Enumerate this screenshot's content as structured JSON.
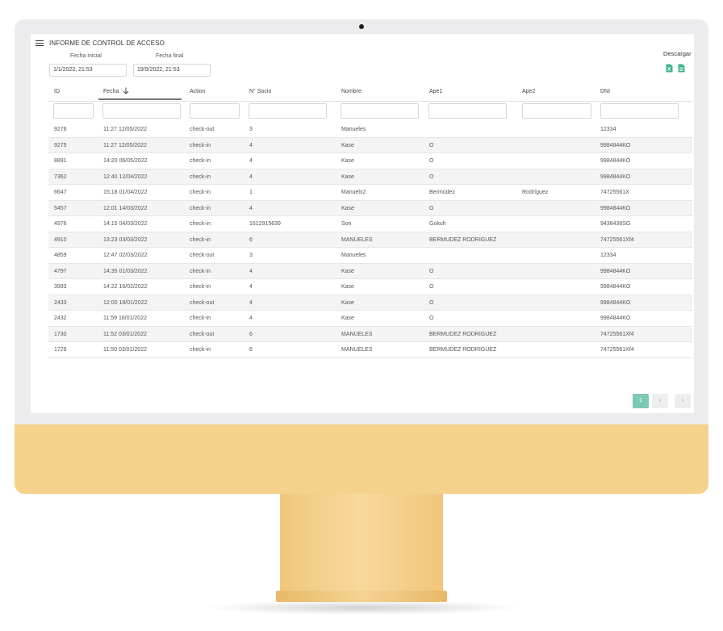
{
  "header": {
    "title": "INFORME DE CONTROL DE ACCESO"
  },
  "filters": {
    "start_label": "Fecha inicial",
    "start_value": "1/1/2022, 21:53",
    "end_label": "Fecha final",
    "end_value": "19/9/2022, 21:53"
  },
  "download": {
    "label": "Descargar",
    "excel_icon": "excel-file-icon",
    "csv_icon": "csv-file-icon",
    "icon_color": "#3fb28f"
  },
  "table": {
    "columns": [
      "ID",
      "Fecha",
      "Action",
      "N° Socio",
      "Nombre",
      "Ape1",
      "Ape2",
      "DNI"
    ],
    "sort_icon": "arrow-down-icon",
    "rows": [
      [
        "9276",
        "11:27 12/05/2022",
        "check-out",
        "3",
        "Manueles",
        "",
        "",
        "12334"
      ],
      [
        "9275",
        "11:27 12/05/2022",
        "check-in",
        "4",
        "Kase",
        "O",
        "",
        "9984844KO"
      ],
      [
        "8891",
        "14:20 06/05/2022",
        "check-in",
        "4",
        "Kase",
        "O",
        "",
        "9984844KO"
      ],
      [
        "7362",
        "12:40 12/04/2022",
        "check-in",
        "4",
        "Kase",
        "O",
        "",
        "9984844KO"
      ],
      [
        "6647",
        "15:18 01/04/2022",
        "check-in",
        "1",
        "Manuelx2",
        "Bermúdez",
        "Rodríguez",
        "74725561X"
      ],
      [
        "5457",
        "12:01 14/03/2022",
        "check-in",
        "4",
        "Kase",
        "O",
        "",
        "9984844KO"
      ],
      [
        "4976",
        "14:15 04/03/2022",
        "check-in",
        "1612915639",
        "Son",
        "Gokuh",
        "",
        "9438438SG"
      ],
      [
        "4910",
        "13:23 03/03/2022",
        "check-in",
        "6",
        "MANUELES",
        "BERMUDEZ RODRIGUEZ",
        "",
        "74725561Xf4"
      ],
      [
        "4859",
        "12:47 02/03/2022",
        "check-out",
        "3",
        "Manueles",
        "",
        "",
        "12334"
      ],
      [
        "4797",
        "14:35 01/03/2022",
        "check-in",
        "4",
        "Kase",
        "O",
        "",
        "9984844KO"
      ],
      [
        "3993",
        "14:22 16/02/2022",
        "check-in",
        "4",
        "Kase",
        "O",
        "",
        "9984844KO"
      ],
      [
        "2433",
        "12:00 18/01/2022",
        "check-out",
        "4",
        "Kase",
        "O",
        "",
        "9984844KO"
      ],
      [
        "2432",
        "11:59 18/01/2022",
        "check-in",
        "4",
        "Kase",
        "O",
        "",
        "9984844KO"
      ],
      [
        "1730",
        "11:52 03/01/2022",
        "check-out",
        "6",
        "MANUELES",
        "BERMUDEZ RODRIGUEZ",
        "",
        "74725561Xf4"
      ],
      [
        "1729",
        "11:50 03/01/2022",
        "check-in",
        "6",
        "MANUELES",
        "BERMUDEZ RODRIGUEZ",
        "",
        "74725561Xf4"
      ]
    ]
  },
  "pagination": {
    "current": "1",
    "prev": "‹",
    "next": "›",
    "active_color": "#7cc9b5"
  },
  "device": {
    "chin_color": "#f6d18c",
    "bezel_color": "#ececee"
  }
}
